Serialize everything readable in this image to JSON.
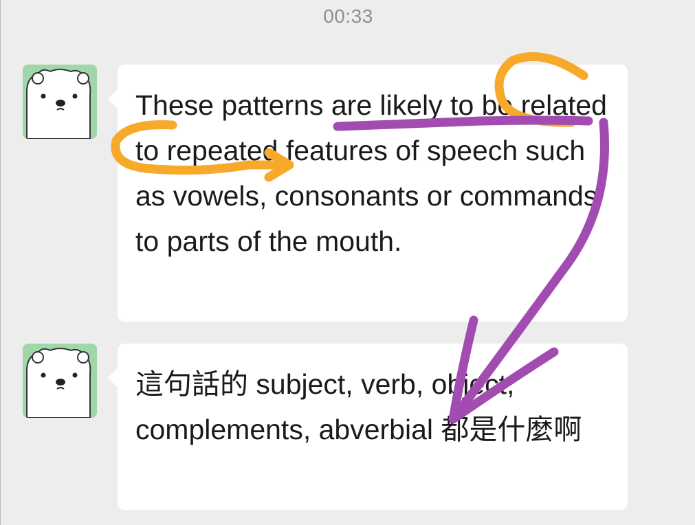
{
  "chat": {
    "timestamp": "00:33",
    "messages": [
      {
        "sender_avatar": "polar-bear-avatar",
        "text": "These patterns are likely to be related to repeated features of speech such as vowels, consonants or commands to parts of the mouth."
      },
      {
        "sender_avatar": "polar-bear-avatar",
        "text": "這句話的 subject, verb, object, complements, abverbial 都是什麼啊"
      }
    ]
  },
  "annotations": {
    "colors": {
      "orange": "#f7a92a",
      "purple": "#a24bb0"
    }
  },
  "colors": {
    "background": "#ededed",
    "bubble": "#ffffff",
    "avatar_bg": "#9fd7a8",
    "timestamp": "#8f8f8f"
  }
}
